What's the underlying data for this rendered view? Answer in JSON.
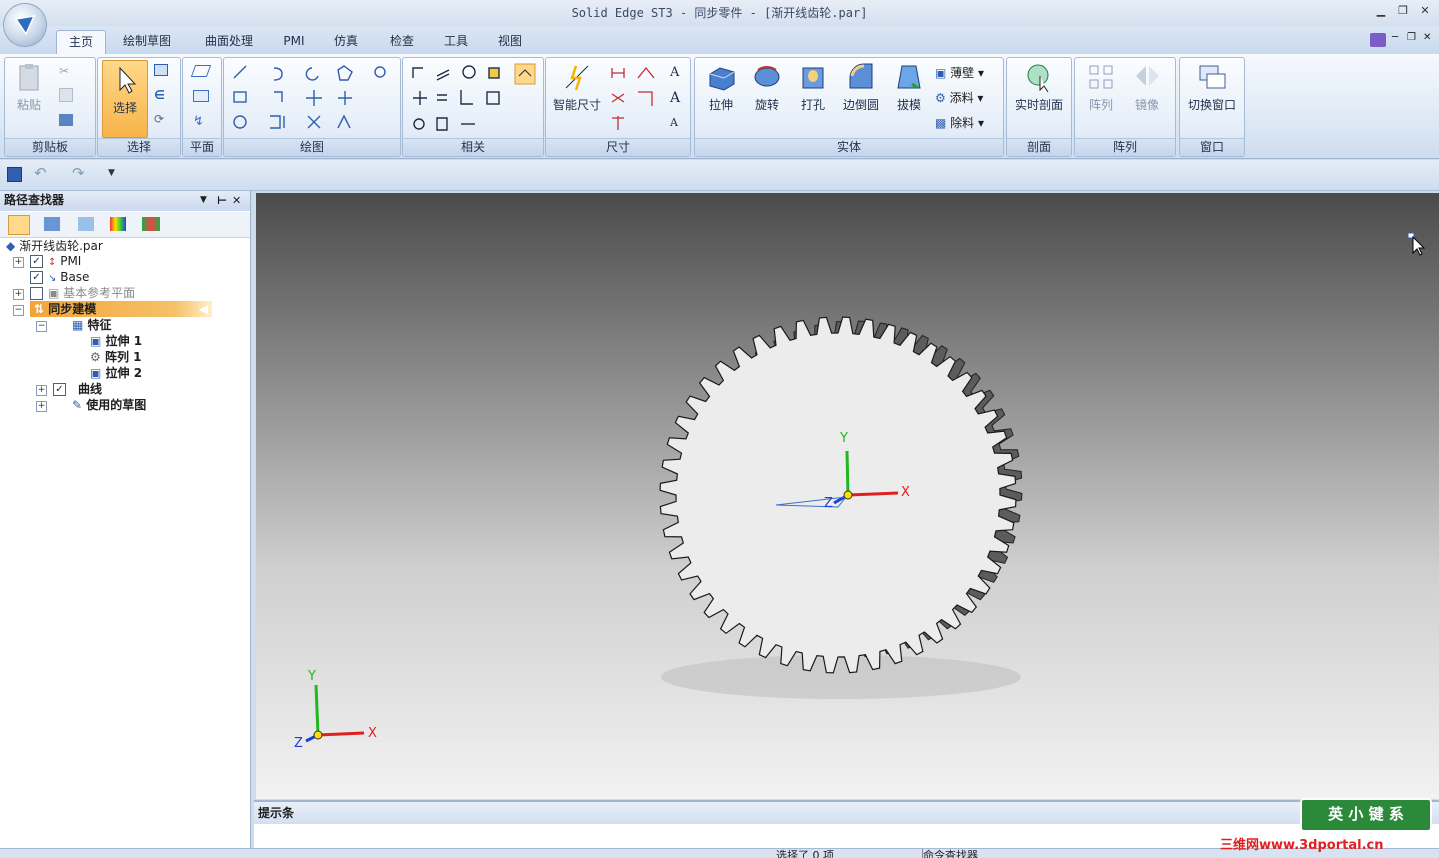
{
  "window": {
    "title": "Solid Edge ST3 - 同步零件 - [渐开线齿轮.par]",
    "controls": [
      "minimize-icon",
      "restore-icon",
      "close-icon"
    ]
  },
  "tabs": [
    {
      "label": "主页",
      "active": true
    },
    {
      "label": "绘制草图"
    },
    {
      "label": "曲面处理"
    },
    {
      "label": "PMI"
    },
    {
      "label": "仿真"
    },
    {
      "label": "检查"
    },
    {
      "label": "工具"
    },
    {
      "label": "视图"
    }
  ],
  "ribbon": {
    "groups": {
      "clipboard": {
        "label": "剪贴板",
        "paste": "粘贴"
      },
      "select": {
        "label": "选择",
        "select": "选择"
      },
      "plane": {
        "label": "平面"
      },
      "draw": {
        "label": "绘图"
      },
      "relate": {
        "label": "相关"
      },
      "dimension": {
        "label": "尺寸",
        "smart": "智能尺寸"
      },
      "solid": {
        "label": "实体",
        "extrude": "拉伸",
        "revolve": "旋转",
        "hole": "打孔",
        "round": "边倒圆",
        "draft": "拔模",
        "thin": "薄壁",
        "add": "添料",
        "cut": "除料"
      },
      "section": {
        "label": "剖面",
        "live": "实时剖面"
      },
      "pattern": {
        "label": "阵列",
        "pattern": "阵列",
        "mirror": "镜像"
      },
      "window": {
        "label": "窗口",
        "switch": "切换窗口"
      }
    }
  },
  "pathfinder": {
    "title": "路径查找器",
    "root": "渐开线齿轮.par",
    "items": {
      "pmi": "PMI",
      "base": "Base",
      "refplanes": "基本参考平面",
      "sync": "同步建模",
      "features": "特征",
      "extrude1": "拉伸 1",
      "pattern1": "阵列 1",
      "extrude2": "拉伸 2",
      "curves": "曲线",
      "sketches": "使用的草图"
    }
  },
  "viewport": {
    "axis_labels": {
      "x": "X",
      "y": "Y",
      "z": "Z"
    }
  },
  "prompt": {
    "title": "提示条"
  },
  "status": {
    "selection": "选择了 0 项",
    "finder": "命令查找器"
  },
  "watermark": {
    "site": "三维网www.3dportal.cn",
    "badge": "英 小 键 系"
  },
  "colors": {
    "accent": "#f2a43b",
    "axis_x": "#e02020",
    "axis_y": "#1fb81f",
    "axis_z": "#1a3fd6"
  }
}
